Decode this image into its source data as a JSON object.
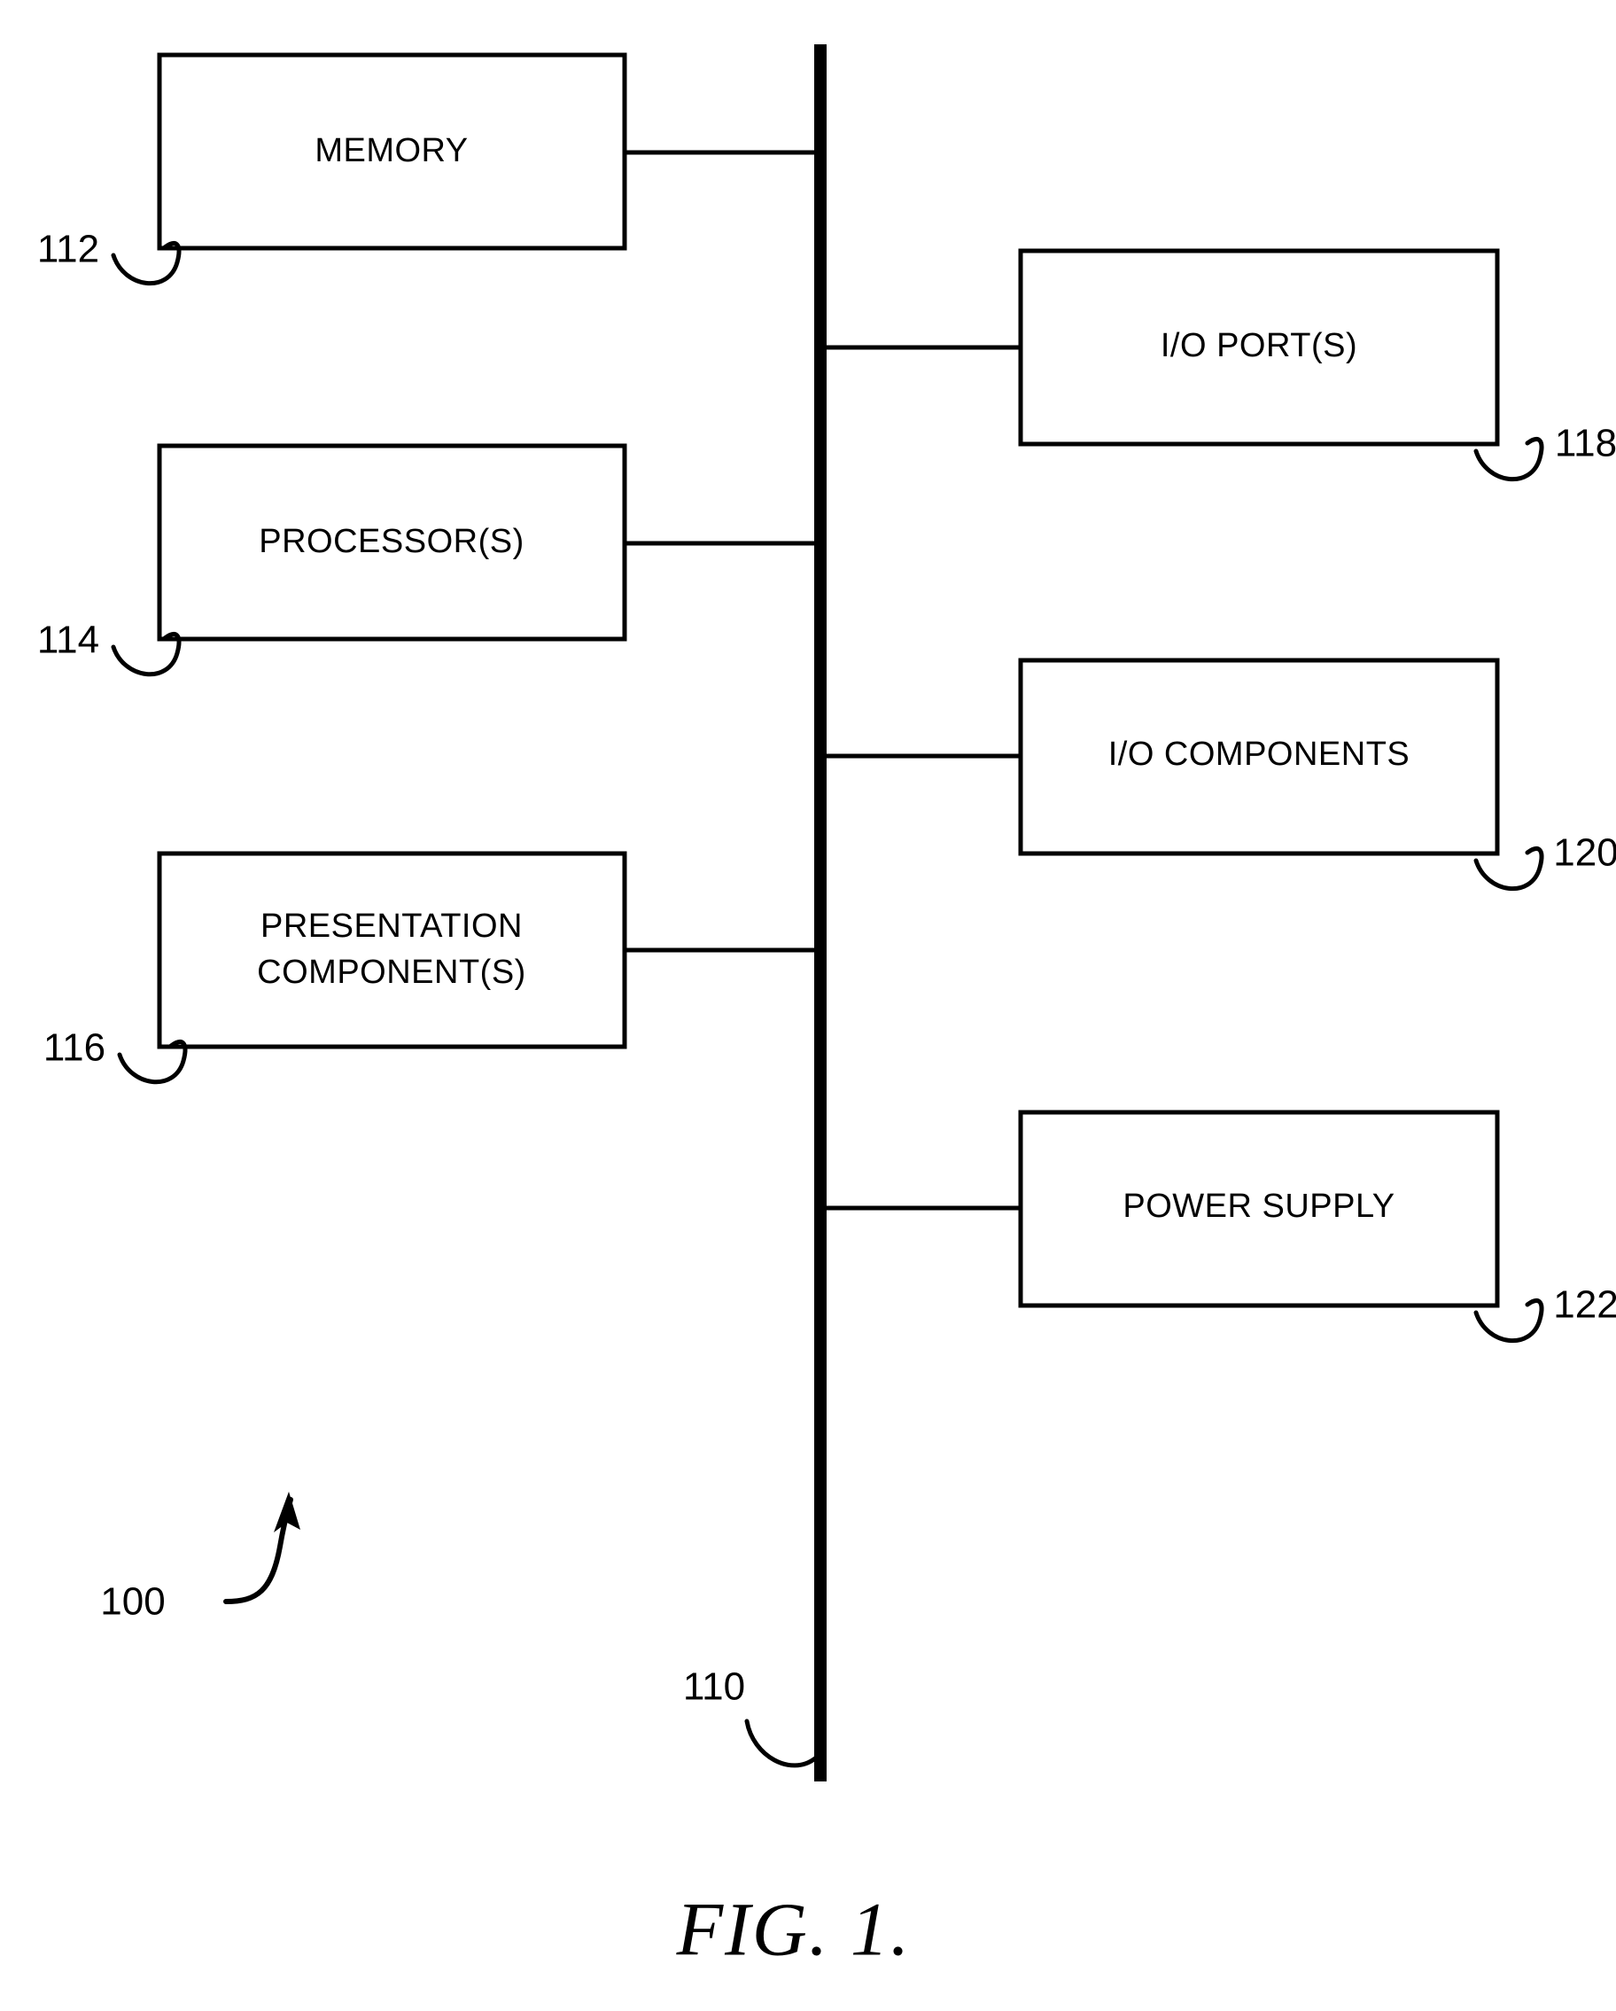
{
  "figure": {
    "caption": "FIG. 1.",
    "system_ref": "100",
    "bus_ref": "110",
    "bus_name": "bus"
  },
  "left_blocks": [
    {
      "id": "memory",
      "label_lines": [
        "MEMORY"
      ],
      "ref": "112"
    },
    {
      "id": "processors",
      "label_lines": [
        "PROCESSOR(S)"
      ],
      "ref": "114"
    },
    {
      "id": "presentation-components",
      "label_lines": [
        "PRESENTATION",
        "COMPONENT(S)"
      ],
      "ref": "116"
    }
  ],
  "right_blocks": [
    {
      "id": "io-ports",
      "label_lines": [
        "I/O PORT(S)"
      ],
      "ref": "118"
    },
    {
      "id": "io-components",
      "label_lines": [
        "I/O COMPONENTS"
      ],
      "ref": "120"
    },
    {
      "id": "power-supply",
      "label_lines": [
        "POWER SUPPLY"
      ],
      "ref": "122"
    }
  ],
  "colors": {
    "stroke": "#000000",
    "background": "#ffffff"
  }
}
